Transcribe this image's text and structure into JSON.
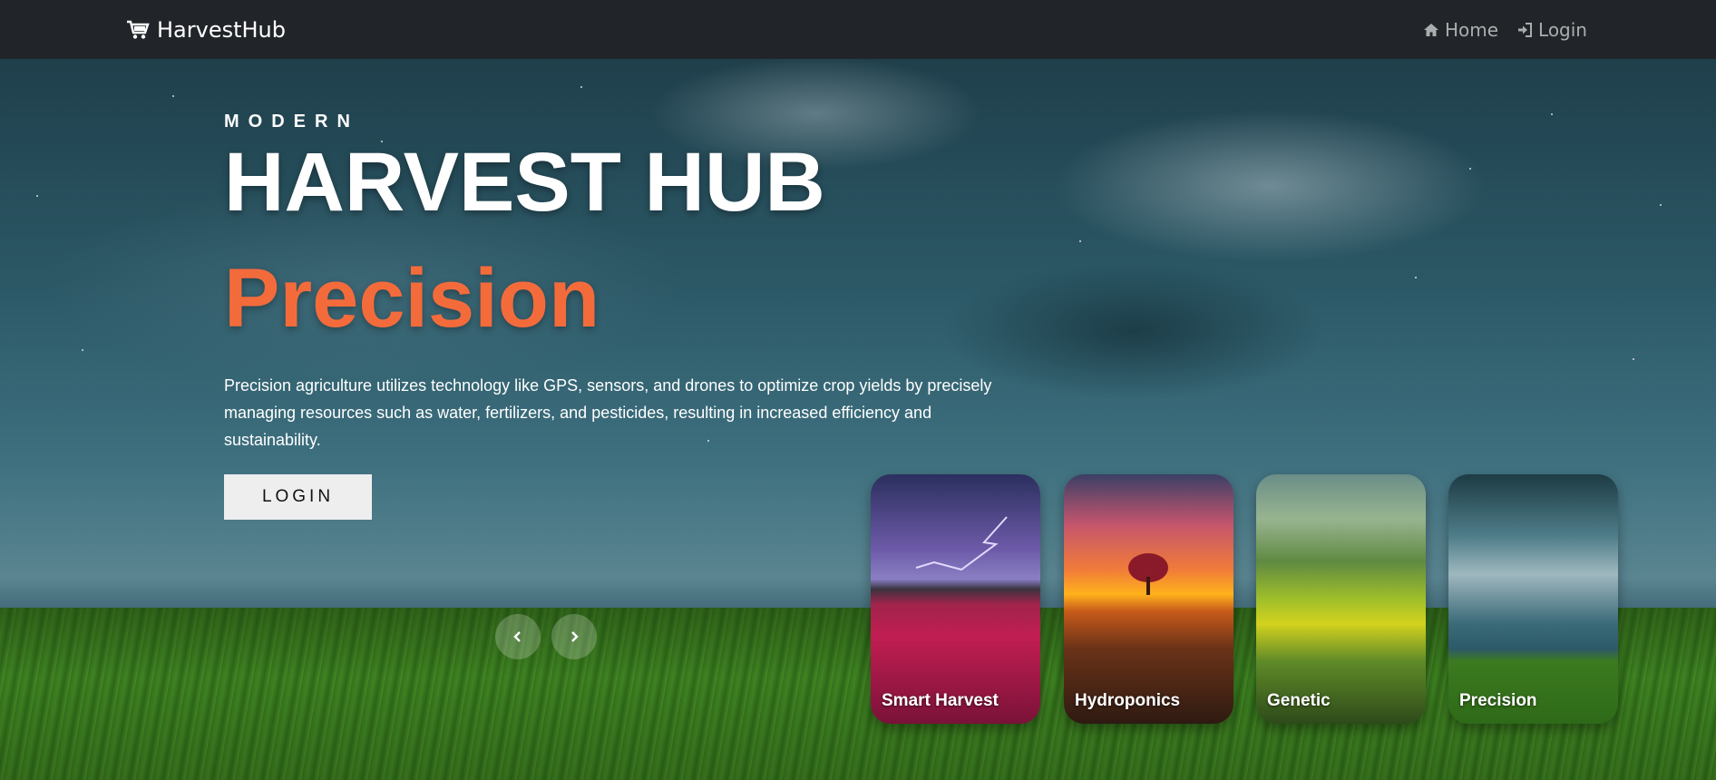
{
  "navbar": {
    "brand": "HarvestHub",
    "brand_icon": "cart-icon",
    "links": [
      {
        "label": "Home",
        "icon": "home-icon"
      },
      {
        "label": "Login",
        "icon": "login-icon"
      }
    ]
  },
  "hero": {
    "eyebrow": "MODERN",
    "title": "HARVEST HUB",
    "subtitle": "Precision",
    "description": "Precision agriculture utilizes technology like GPS, sensors, and drones to optimize crop yields by precisely managing resources such as water, fertilizers, and pesticides, resulting in increased efficiency and sustainability.",
    "cta_label": "LOGIN",
    "accent_color": "#f46b3b"
  },
  "carousel": {
    "prev_icon": "chevron-left-icon",
    "next_icon": "chevron-right-icon",
    "cards": [
      {
        "label": "Smart Harvest"
      },
      {
        "label": "Hydroponics"
      },
      {
        "label": "Genetic"
      },
      {
        "label": "Precision"
      }
    ]
  }
}
